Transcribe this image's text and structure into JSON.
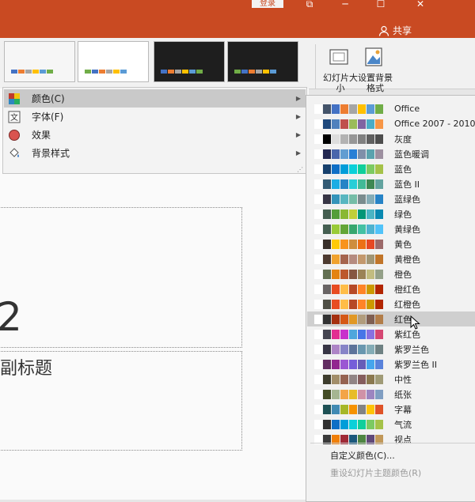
{
  "title_bar": {
    "sign_in": "登录",
    "share": "共享",
    "ribbon_restore_glyph": "⧉",
    "minimize_glyph": "─",
    "maximize_glyph": "☐",
    "close_glyph": "✕",
    "accent": "#c94a22"
  },
  "ribbon": {
    "variants": [
      {
        "bg": "#f6f6f6",
        "colors": [
          "#4472c4",
          "#ed7d31",
          "#a5a5a5",
          "#ffc000",
          "#5b9bd5",
          "#70ad47"
        ]
      },
      {
        "bg": "#ffffff",
        "colors": [
          "#70ad47",
          "#4472c4",
          "#ed7d31",
          "#a5a5a5",
          "#ffc000",
          "#5b9bd5"
        ]
      },
      {
        "bg": "#1e1e1e",
        "colors": [
          "#4472c4",
          "#ed7d31",
          "#a5a5a5",
          "#ffc000",
          "#5b9bd5",
          "#70ad47"
        ]
      },
      {
        "bg": "#1e1e1e",
        "colors": [
          "#70ad47",
          "#4472c4",
          "#ed7d31",
          "#a5a5a5",
          "#ffc000",
          "#5b9bd5"
        ]
      }
    ],
    "slide_size_label": "幻灯片大小",
    "format_bg_label": "设置背景格式"
  },
  "slide": {
    "number": "2",
    "subtitle": "副标题"
  },
  "variants_menu": {
    "items": [
      {
        "label": "颜色(C)",
        "arrow": "▶"
      },
      {
        "label": "字体(F)",
        "arrow": "▶"
      },
      {
        "label": "效果",
        "arrow": "▶"
      },
      {
        "label": "背景样式",
        "arrow": "▶"
      }
    ],
    "grip": "⋰"
  },
  "colors_menu": {
    "schemes": [
      {
        "name": "Office",
        "colors": [
          "#ffffff",
          "#44546a",
          "#4472c4",
          "#ed7d31",
          "#a5a5a5",
          "#ffc000",
          "#5b9bd5",
          "#70ad47"
        ]
      },
      {
        "name": "Office 2007 - 2010",
        "colors": [
          "#ffffff",
          "#1f497d",
          "#4f81bd",
          "#c0504d",
          "#9bbb59",
          "#8064a2",
          "#4bacc6",
          "#f79646"
        ]
      },
      {
        "name": "灰度",
        "colors": [
          "#ffffff",
          "#000000",
          "#dddddd",
          "#b2b2b2",
          "#969696",
          "#808080",
          "#5f5f5f",
          "#4d4d4d"
        ]
      },
      {
        "name": "蓝色暖调",
        "colors": [
          "#ffffff",
          "#242852",
          "#4a66ac",
          "#629dd1",
          "#297fd5",
          "#7f8fa9",
          "#5aa2ae",
          "#9d90a0"
        ]
      },
      {
        "name": "蓝色",
        "colors": [
          "#ffffff",
          "#17406d",
          "#0f6fc6",
          "#009dd9",
          "#0bd0d9",
          "#10cf9b",
          "#7cca62",
          "#a5c249"
        ]
      },
      {
        "name": "蓝色 II",
        "colors": [
          "#ffffff",
          "#335b74",
          "#1cade4",
          "#2683c6",
          "#27ced7",
          "#42ba97",
          "#3e8853",
          "#62a39f"
        ]
      },
      {
        "name": "蓝绿色",
        "colors": [
          "#ffffff",
          "#373545",
          "#3494ba",
          "#58b6c0",
          "#75bda7",
          "#7a8c8e",
          "#84acb6",
          "#2683c6"
        ]
      },
      {
        "name": "绿色",
        "colors": [
          "#ffffff",
          "#455f51",
          "#549e39",
          "#8ab833",
          "#c0cf3a",
          "#029676",
          "#4ab5c4",
          "#0989b1"
        ]
      },
      {
        "name": "黄绿色",
        "colors": [
          "#ffffff",
          "#455f51",
          "#99cb38",
          "#63a537",
          "#37a76f",
          "#44c1a3",
          "#4eb3cf",
          "#51c3f9"
        ]
      },
      {
        "name": "黄色",
        "colors": [
          "#ffffff",
          "#39302a",
          "#ffca08",
          "#f8931d",
          "#ce8d3e",
          "#ec7016",
          "#e64823",
          "#9c6a6a"
        ]
      },
      {
        "name": "黄橙色",
        "colors": [
          "#ffffff",
          "#4e3b30",
          "#f0a22e",
          "#a5644e",
          "#b58b80",
          "#c3986d",
          "#a19574",
          "#c17529"
        ]
      },
      {
        "name": "橙色",
        "colors": [
          "#ffffff",
          "#637052",
          "#e48312",
          "#bd582c",
          "#865640",
          "#9b8357",
          "#c2bc80",
          "#94a088"
        ]
      },
      {
        "name": "橙红色",
        "colors": [
          "#ffffff",
          "#696464",
          "#e84c22",
          "#ffbd47",
          "#b64926",
          "#ff8427",
          "#cc9900",
          "#b22600"
        ]
      },
      {
        "name": "红橙色",
        "colors": [
          "#ffffff",
          "#505046",
          "#e84c22",
          "#ffbd47",
          "#b64926",
          "#ff8427",
          "#cc9900",
          "#b22600"
        ]
      },
      {
        "name": "红色",
        "colors": [
          "#ffffff",
          "#323232",
          "#a5300f",
          "#d55816",
          "#e19825",
          "#b19c7d",
          "#7f5f52",
          "#b27d49"
        ]
      },
      {
        "name": "紫红色",
        "colors": [
          "#ffffff",
          "#454551",
          "#e32d91",
          "#c830cc",
          "#4ea6dc",
          "#4775e7",
          "#8971e1",
          "#d54773"
        ]
      },
      {
        "name": "紫罗兰色",
        "colors": [
          "#ffffff",
          "#373545",
          "#ad84c6",
          "#8784c7",
          "#5d739a",
          "#6997af",
          "#84acb6",
          "#6f8183"
        ]
      },
      {
        "name": "紫罗兰色 II",
        "colors": [
          "#ffffff",
          "#632e62",
          "#92278f",
          "#9b57d3",
          "#755dd9",
          "#665eb8",
          "#45a5ed",
          "#5982db"
        ]
      },
      {
        "name": "中性",
        "colors": [
          "#ffffff",
          "#3e3d2d",
          "#a28e6a",
          "#956251",
          "#918485",
          "#855d5d",
          "#8a784f",
          "#a09b77"
        ]
      },
      {
        "name": "纸张",
        "colors": [
          "#ffffff",
          "#444d26",
          "#a5b592",
          "#f3a447",
          "#e7bc29",
          "#d092a7",
          "#9c85c0",
          "#809ec2"
        ]
      },
      {
        "name": "字幕",
        "colors": [
          "#ffffff",
          "#1e5155",
          "#418ab3",
          "#a6b727",
          "#f69200",
          "#838383",
          "#fec306",
          "#df5327"
        ]
      },
      {
        "name": "气流",
        "colors": [
          "#ffffff",
          "#323232",
          "#0f6fc6",
          "#009dd9",
          "#0bd0d9",
          "#10cf9b",
          "#7cca62",
          "#a5c249"
        ]
      },
      {
        "name": "视点",
        "colors": [
          "#ffffff",
          "#3a3a3a",
          "#f07f09",
          "#9f2936",
          "#1b587c",
          "#4e8542",
          "#604878",
          "#c19859"
        ]
      }
    ],
    "custom_colors": "自定义颜色(C)...",
    "reset_colors": "重设幻灯片主题颜色(R)"
  }
}
